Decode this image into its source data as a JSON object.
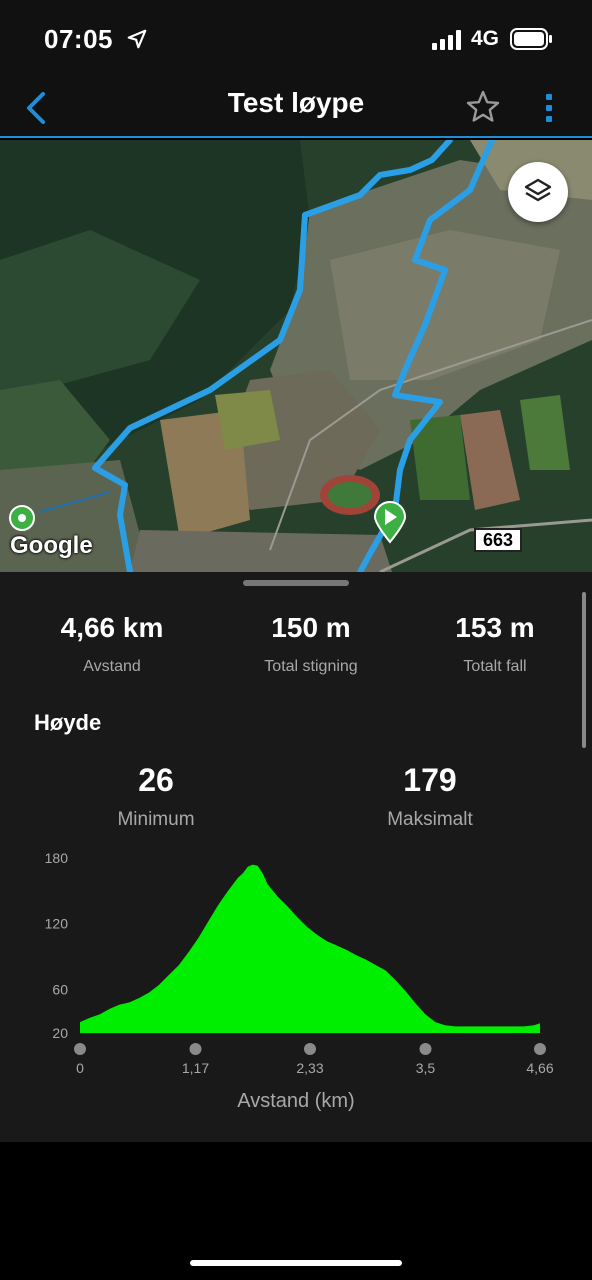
{
  "status": {
    "time": "07:05",
    "network": "4G",
    "icons": [
      "location-arrow-icon",
      "signal-icon",
      "battery-icon"
    ]
  },
  "nav": {
    "title": "Test løype",
    "icons": [
      "chevron-left-icon",
      "star-icon",
      "more-vertical-icon"
    ],
    "accent": "#1e8ed8"
  },
  "map": {
    "attribution": "Google",
    "road_number": "663",
    "layers_icon": "layers-icon",
    "route_color": "#2b9fe6",
    "start_marker_color": "#3cb043"
  },
  "stats": [
    {
      "value": "4,66 km",
      "label": "Avstand"
    },
    {
      "value": "150 m",
      "label": "Total stigning"
    },
    {
      "value": "153 m",
      "label": "Totalt fall"
    }
  ],
  "elevation": {
    "title": "Høyde",
    "min_value": "26",
    "min_label": "Minimum",
    "max_value": "179",
    "max_label": "Maksimalt"
  },
  "chart_data": {
    "type": "area",
    "xlabel": "Avstand (km)",
    "ylabel": "",
    "fill_color": "#00ee00",
    "x_ticks": [
      "0",
      "1,17",
      "2,33",
      "3,5",
      "4,66"
    ],
    "y_ticks": [
      "180",
      "120",
      "60",
      "20"
    ],
    "xlim": [
      0,
      4.66
    ],
    "ylim": [
      20,
      180
    ],
    "x": [
      0,
      0.1,
      0.2,
      0.3,
      0.4,
      0.5,
      0.6,
      0.7,
      0.8,
      0.9,
      1.0,
      1.1,
      1.2,
      1.3,
      1.4,
      1.5,
      1.6,
      1.65,
      1.7,
      1.75,
      1.8,
      1.85,
      1.9,
      2.0,
      2.1,
      2.2,
      2.3,
      2.4,
      2.5,
      2.6,
      2.7,
      2.8,
      2.9,
      3.0,
      3.1,
      3.2,
      3.3,
      3.4,
      3.5,
      3.6,
      3.7,
      3.8,
      3.9,
      4.0,
      4.1,
      4.2,
      4.3,
      4.4,
      4.5,
      4.6,
      4.66
    ],
    "y": [
      30,
      34,
      37,
      42,
      46,
      48,
      52,
      57,
      64,
      73,
      82,
      94,
      107,
      122,
      137,
      150,
      162,
      166,
      172,
      174,
      173,
      166,
      156,
      145,
      136,
      126,
      117,
      110,
      104,
      100,
      96,
      91,
      87,
      82,
      77,
      68,
      58,
      47,
      37,
      30,
      27,
      26,
      26,
      26,
      26,
      26,
      26,
      26,
      26,
      27,
      29
    ]
  }
}
